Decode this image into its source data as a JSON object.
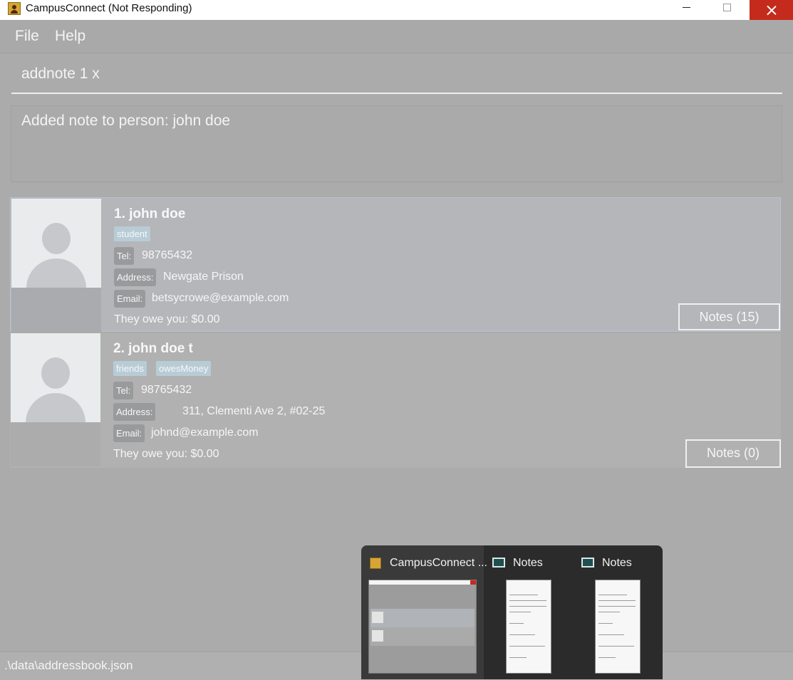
{
  "window": {
    "title": "CampusConnect (Not Responding)"
  },
  "menu": {
    "file": "File",
    "help": "Help"
  },
  "command": {
    "value": "addnote 1 x"
  },
  "result": {
    "message": "Added note to person: john doe"
  },
  "persons": [
    {
      "index_name": "1.  john doe",
      "tags": [
        "student"
      ],
      "tel_label": "Tel:",
      "tel": "98765432",
      "address_label": "Address:",
      "address": "Newgate Prison",
      "email_label": "Email:",
      "email": "betsycrowe@example.com",
      "owe": "They owe you: $0.00",
      "notes_button": "Notes (15)",
      "selected": true
    },
    {
      "index_name": "2.  john doe t",
      "tags": [
        "friends",
        "owesMoney"
      ],
      "tel_label": "Tel:",
      "tel": "98765432",
      "address_label": "Address:",
      "address": "311, Clementi Ave 2, #02-25",
      "email_label": "Email:",
      "email": "johnd@example.com",
      "owe": "They owe you: $0.00",
      "notes_button": "Notes (0)",
      "selected": false
    }
  ],
  "status": {
    "path": ".\\data\\addressbook.json"
  },
  "taskbar_preview": {
    "items": [
      {
        "label": "CampusConnect ...",
        "icon": "campusconnect-icon"
      },
      {
        "label": "Notes",
        "icon": "notes-icon"
      },
      {
        "label": "Notes",
        "icon": "notes-icon"
      }
    ]
  },
  "colors": {
    "close_button": "#c42b1c",
    "tag_bg": "#b8ccd6",
    "overlay_bg": "#ababab"
  }
}
